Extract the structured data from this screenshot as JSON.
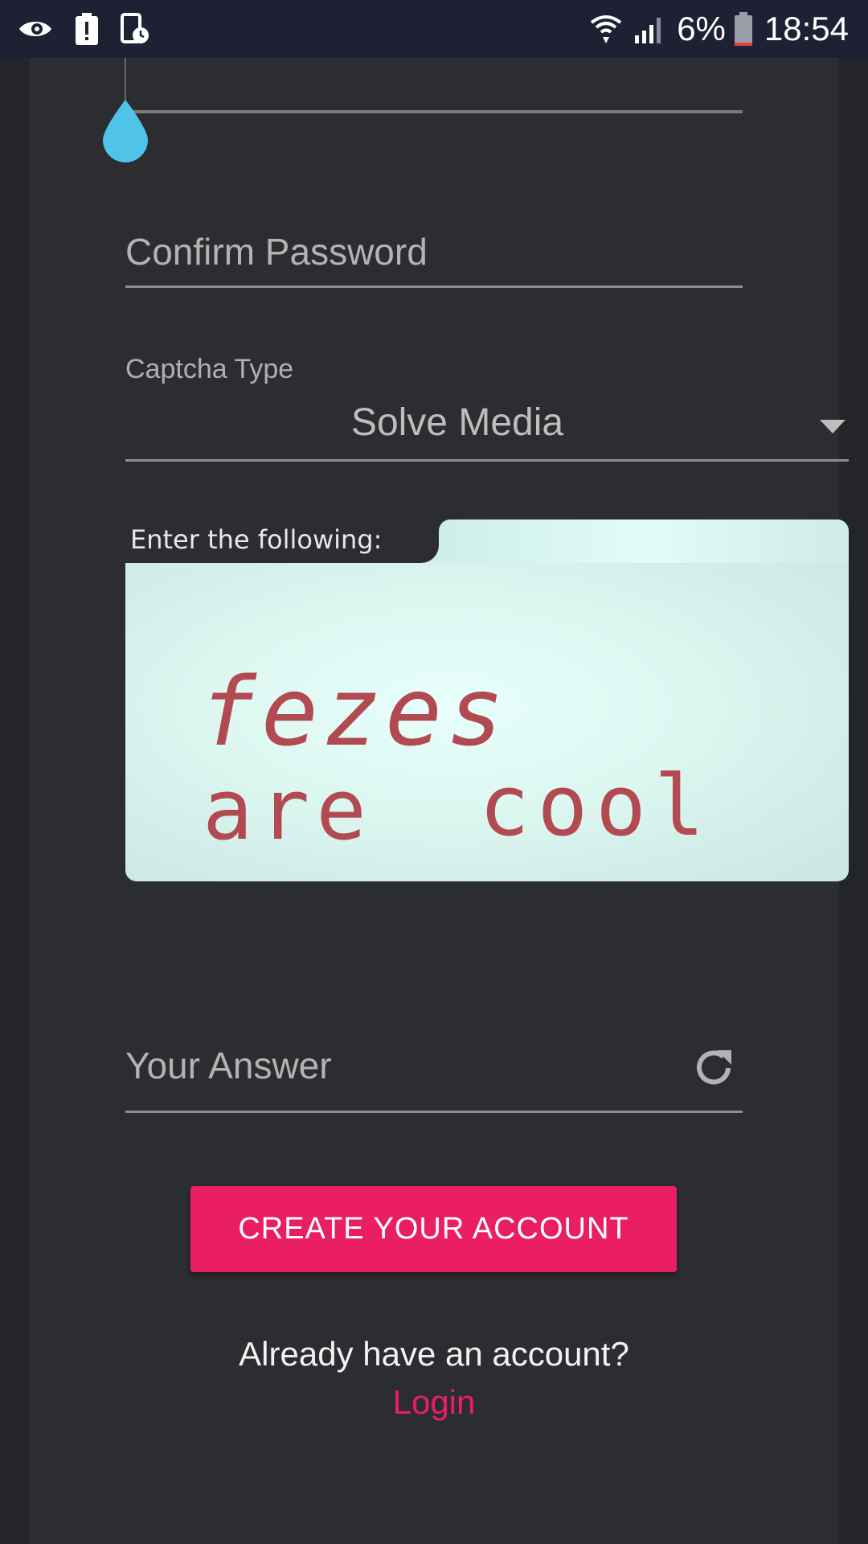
{
  "status_bar": {
    "left_icons": [
      "eye-notification-icon",
      "alert-icon",
      "screen-timer-icon"
    ],
    "wifi_icon": "wifi-icon",
    "signal_icon": "cell-signal-icon",
    "battery_percent": "6%",
    "battery_icon": "battery-low-icon",
    "time": "18:54"
  },
  "form": {
    "confirm_password": {
      "placeholder": "Confirm Password",
      "value": ""
    },
    "captcha_type": {
      "label": "Captcha Type",
      "selected": "Solve Media"
    },
    "captcha": {
      "prompt": "Enter the following:",
      "text_line1": "fezes",
      "text_line2a": "are",
      "text_line2b": "cool"
    },
    "answer": {
      "placeholder": "Your Answer",
      "value": ""
    },
    "create_button": "CREATE YOUR ACCOUNT",
    "already_text": "Already have an account?",
    "login_link": "Login"
  },
  "colors": {
    "accent": "#e91e63",
    "slider_thumb": "#4fc3e8",
    "status_bar_bg": "#1d2133",
    "panel_bg": "#2c2d31",
    "captcha_text": "#b24a52"
  }
}
